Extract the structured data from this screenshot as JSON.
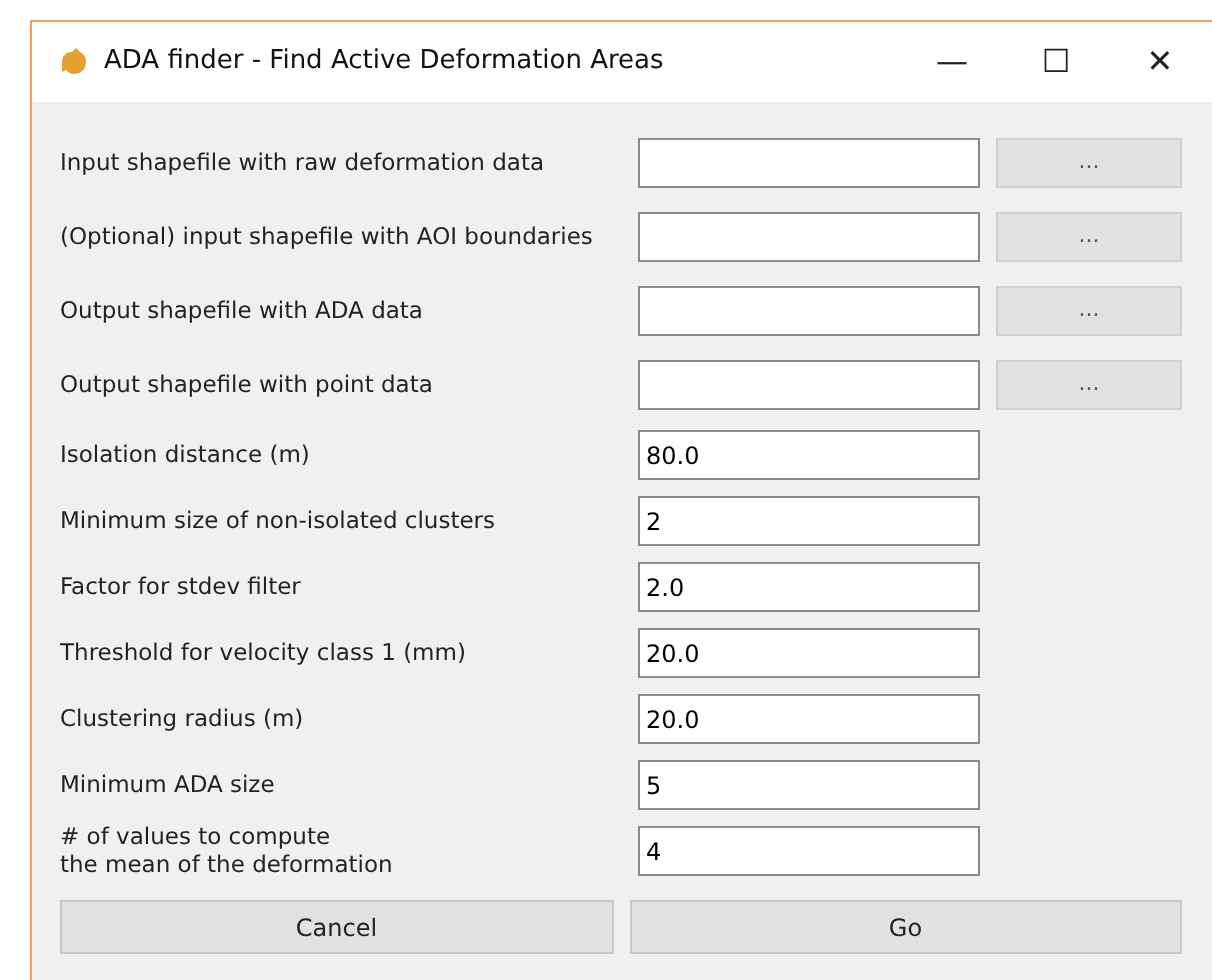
{
  "window": {
    "title": "ADA finder - Find Active Deformation Areas",
    "controls": [
      "—",
      "☐",
      "✕"
    ]
  },
  "fields": [
    {
      "kind": "file",
      "label": "Input shapefile with raw deformation data",
      "browse": "..."
    },
    {
      "kind": "file",
      "label": "(Optional) input shapefile with AOI boundaries",
      "browse": "..."
    },
    {
      "kind": "file",
      "label": "Output shapefile with ADA data",
      "browse": "..."
    },
    {
      "kind": "file",
      "label": "Output shapefile with point data",
      "browse": "..."
    },
    {
      "kind": "number",
      "label": "Isolation distance (m)",
      "value": "80.0"
    },
    {
      "kind": "number",
      "label": "Minimum size of non-isolated clusters",
      "value": "2"
    },
    {
      "kind": "number",
      "label": "Factor for stdev filter",
      "value": "2.0"
    },
    {
      "kind": "number",
      "label": "Threshold for velocity class 1 (mm)",
      "value": "20.0"
    },
    {
      "kind": "number",
      "label": "Clustering radius (m)",
      "value": "20.0"
    },
    {
      "kind": "number",
      "label": "Minimum ADA size",
      "value": "5"
    },
    {
      "kind": "number",
      "label": "# of values to compute\nthe mean of the deformation",
      "value": "4"
    }
  ],
  "buttons": [
    "Cancel",
    "Go"
  ]
}
